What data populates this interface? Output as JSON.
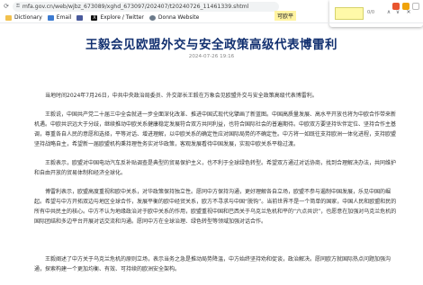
{
  "browser": {
    "url": "mfa.gov.cn/web/wjbz_673089/xghd_673097/202407/t20240726_11461339.shtml",
    "selection": "可欧平",
    "find_text": "",
    "find_count": "0/0",
    "bookmarks": [
      {
        "label": "Dictionary",
        "icon": "folder-icon"
      },
      {
        "label": "Email",
        "icon": "mail-icon"
      },
      {
        "label": "",
        "icon": "app-icon"
      },
      {
        "label": "Explore / Twitter",
        "icon": "x-icon"
      },
      {
        "label": "Donna Website",
        "icon": "globe-icon"
      }
    ]
  },
  "article": {
    "title": "王毅会见欧盟外交与安全政策高级代表博雷利",
    "date": "2024-07-26 19:16",
    "paragraphs": [
      "当地时间2024年7月26日，中共中央政治局委员、外交部长王毅在万象会见欧盟外交与安全政策高级代表博雷利。",
      "王毅说，中国共产党二十届三中全会就进一步全面深化改革、推进中国式现代化擘画了新蓝图。中国高质量发展、高水平开放也将为中欧合作带来新机遇。中欧共识远大于分歧，继续推动中欧关系健康稳定发展符合双方共同利益，也符合国际社会的普遍期待。中欧双方要坚持伙伴定位、坚持合作主基调，尊重各自人民的意愿和选择，平等对话、增进理解，以中欧关系的确定性应对国际局势的不确定性。中方将一如既往支持欧洲一体化进程，支持欧盟坚持战略自主，希望新一届欧盟机构秉持理性务实对华政策，客观发展看待中国发展，实现中欧关系平稳过渡。",
      "王毅表示，欧盟对中国电动汽车反补贴调查是典型的贸易保护主义，也不利于全球绿色转型。希望双方通过对话协商，找到合理解决办法，共同维护和自由开放的贸易体制和经济全球化。",
      "博雷利表示，欧盟高度重视和欧中关系，对华政策保持独立性。愿同中方保持沟通，更好理解各自立场，欧盟不参与遏制中国发展，乐见中国的崛起。希望与中方开拓双边与地区全球合作，发展平衡的欧中经贸关系，欧方不寻求与中国“脱钩”。当前世界不是一个简单的国家，中国人民和欧盟和民的所有中共民主的核心。中方不认为地缘政治对于欧中关系的作用，欧盟重视中国和巴西关于乌克兰危机和平的“六点共识”，也愿意在加强对乌克兰危机的国际团结和多边平台开展对话交流和沟通。愿同中方在全球治理、绿色转型等领域加强对话合作。",
      "王毅阐述了中方关于乌克兰危机的原则立场，表示当务之急是推动局势降温，中方始终坚持劝和促谈，政治解决。愿同欧方就国际热点问题加强沟通，探索构建一个更加均衡、有效、可持续的欧洲安全架构。"
    ]
  },
  "colors": {
    "title": "#123070",
    "highlight": "#fff3a0",
    "find_input": "#fff9a8"
  }
}
